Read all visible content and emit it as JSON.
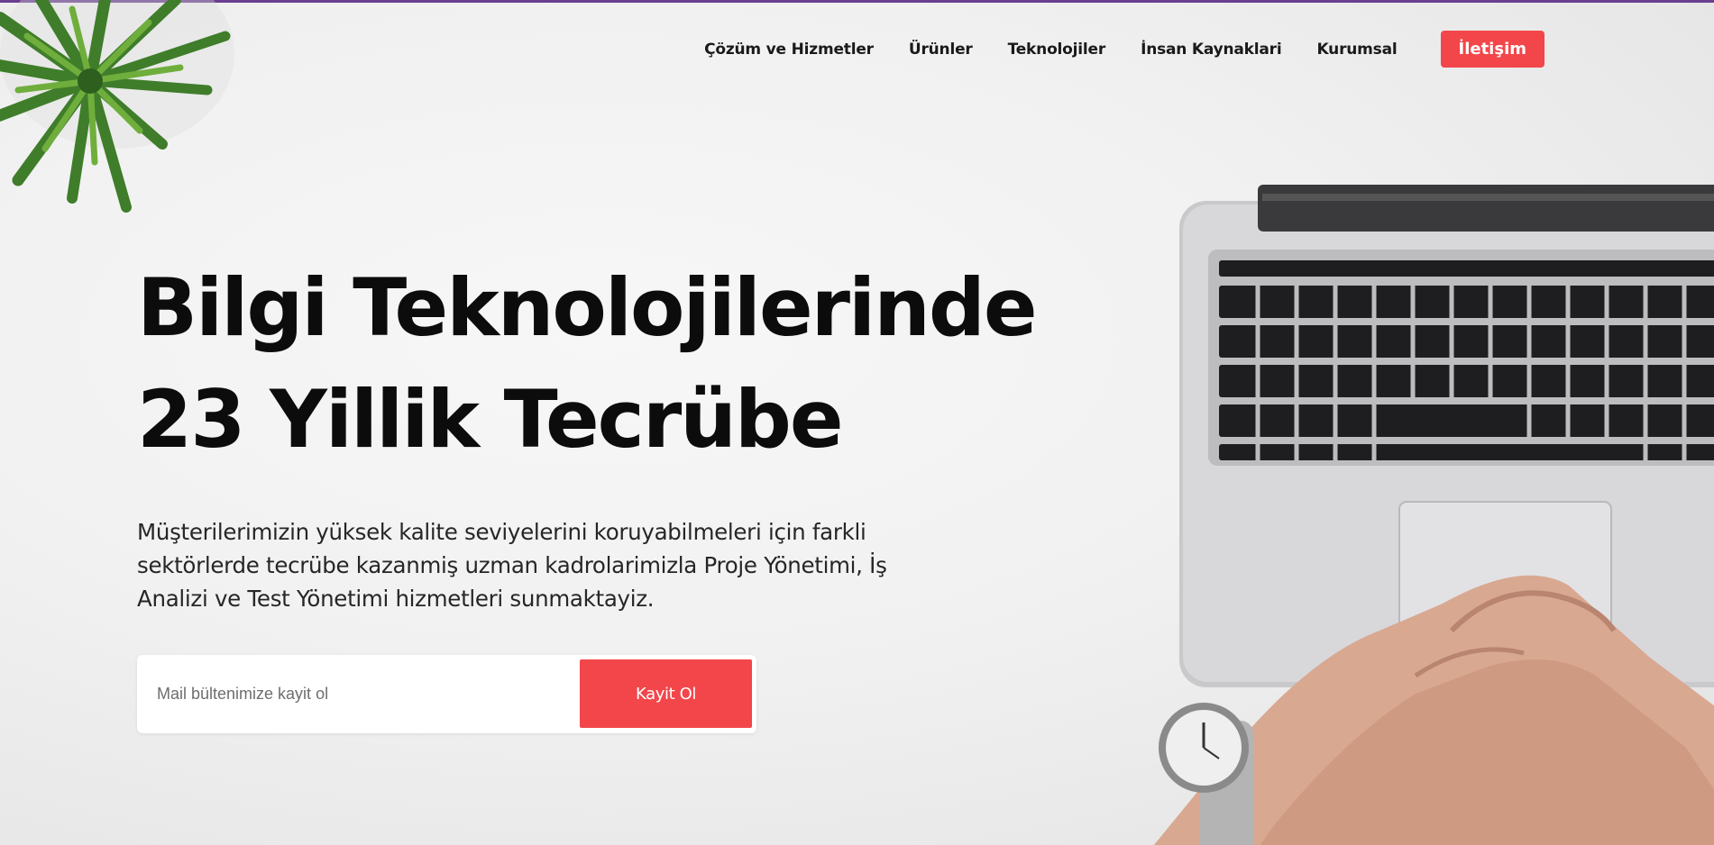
{
  "nav": {
    "items": [
      {
        "label": "Çözüm ve Hizmetler"
      },
      {
        "label": "Ürünler"
      },
      {
        "label": "Teknolojiler"
      },
      {
        "label": "İnsan Kaynaklari"
      },
      {
        "label": "Kurumsal"
      }
    ],
    "cta_label": "İletişim"
  },
  "hero": {
    "title_line1": "Bilgi Teknolojilerinde",
    "title_line2": "23 Yillik Tecrübe",
    "description": "Müşterilerimizin yüksek kalite seviyelerini koruyabilmeleri için farkli sektörlerde tecrübe kazanmiş uzman kadrolarimizla Proje Yönetimi, İş Analizi ve Test Yönetimi hizmetleri sunmaktayiz."
  },
  "subscribe": {
    "input_value": "",
    "placeholder": "Mail bültenimize kayit ol",
    "button_label": "Kayit Ol"
  },
  "colors": {
    "accent": "#f2464b",
    "top_border": "#6b3f8f",
    "text": "#0c0c0c"
  },
  "icons": {
    "plant": "plant-photo",
    "laptop": "laptop-photo",
    "hands": "hands-with-watch-photo"
  }
}
